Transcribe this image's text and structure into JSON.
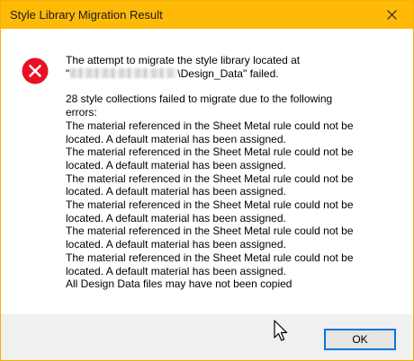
{
  "window": {
    "title": "Style Library Migration Result"
  },
  "message": {
    "intro_line1": "The attempt to migrate the style library located at",
    "path_prefix": "\"",
    "path_suffix": "\\Design_Data\" failed.",
    "summary_line1": "28 style collections failed to migrate due to the following",
    "summary_line2": "errors:",
    "errors": [
      {
        "line1": "The material referenced in the Sheet Metal rule could not be",
        "line2": "located. A default material has been assigned."
      },
      {
        "line1": "The material referenced in the Sheet Metal rule could not be",
        "line2": "located. A default material has been assigned."
      },
      {
        "line1": "The material referenced in the Sheet Metal rule could not be",
        "line2": "located. A default material has been assigned."
      },
      {
        "line1": "The material referenced in the Sheet Metal rule could not be",
        "line2": "located. A default material has been assigned."
      },
      {
        "line1": "The material referenced in the Sheet Metal rule could not be",
        "line2": "located. A default material has been assigned."
      },
      {
        "line1": "The material referenced in the Sheet Metal rule could not be",
        "line2": "located. A default material has been assigned."
      }
    ],
    "final_line": "All Design Data files may have not been copied"
  },
  "buttons": {
    "ok_label": "OK"
  },
  "icons": {
    "error": "error-icon",
    "close": "close-icon",
    "cursor": "mouse-pointer-icon"
  },
  "colors": {
    "titlebar": "#ffba08",
    "error_red": "#e81123",
    "footer": "#f0f0f0",
    "button_border": "#0078d7"
  }
}
